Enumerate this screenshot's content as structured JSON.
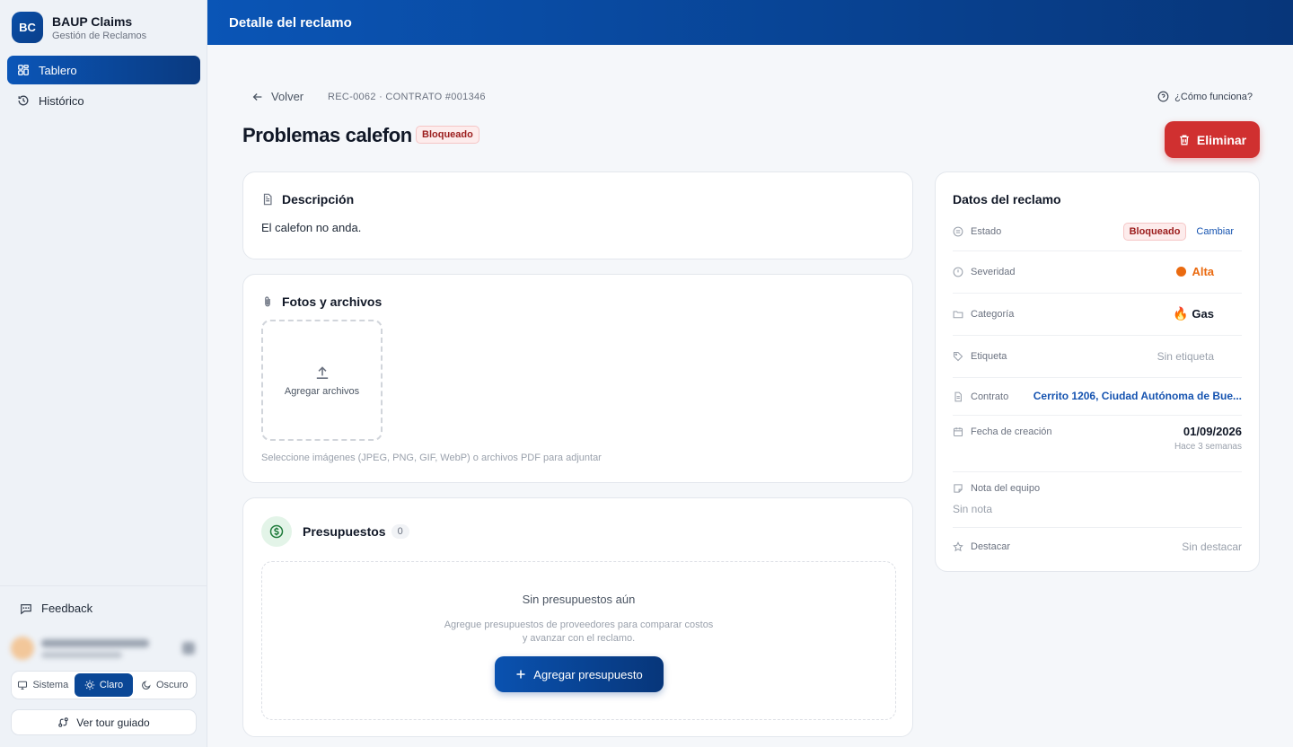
{
  "brand": {
    "initials": "BC",
    "name": "BAUP Claims",
    "subtitle": "Gestión de Reclamos"
  },
  "nav": [
    {
      "label": "Tablero",
      "icon": "dashboard-icon",
      "active": true
    },
    {
      "label": "Histórico",
      "icon": "history-icon",
      "active": false
    }
  ],
  "sidebar_footer": {
    "feedback": "Feedback",
    "theme": {
      "system": "Sistema",
      "light": "Claro",
      "dark": "Oscuro",
      "selected": "Claro"
    },
    "tour": "Ver tour guiado"
  },
  "topbar": {
    "title": "Detalle del reclamo"
  },
  "header": {
    "back": "Volver",
    "breadcrumb": "REC-0062 · CONTRATO #001346",
    "help": "¿Cómo funciona?",
    "title": "Problemas calefon",
    "status": "Bloqueado",
    "delete": "Eliminar"
  },
  "description": {
    "title": "Descripción",
    "text": "El calefon no anda."
  },
  "files": {
    "title": "Fotos y archivos",
    "upload": "Agregar archivos",
    "help": "Seleccione imágenes (JPEG, PNG, GIF, WebP) o archivos PDF para adjuntar"
  },
  "budgets": {
    "title": "Presupuestos",
    "count": "0",
    "empty_title": "Sin presupuestos aún",
    "empty_desc": "Agregue presupuestos de proveedores para comparar costos y avanzar con el reclamo.",
    "add": "Agregar presupuesto"
  },
  "details": {
    "title": "Datos del reclamo",
    "estado": {
      "label": "Estado",
      "value": "Bloqueado",
      "action": "Cambiar"
    },
    "severidad": {
      "label": "Severidad",
      "value": "Alta",
      "color": "#ea6a10"
    },
    "categoria": {
      "label": "Categoría",
      "value": "Gas",
      "emoji": "🔥"
    },
    "etiqueta": {
      "label": "Etiqueta",
      "value": "Sin etiqueta"
    },
    "contrato": {
      "label": "Contrato",
      "value": "Cerrito 1206, Ciudad Autónoma de Bue..."
    },
    "fecha": {
      "label": "Fecha de creación",
      "value": "01/09/2026",
      "relative": "Hace 3 semanas"
    },
    "nota": {
      "label": "Nota del equipo",
      "value": "Sin nota"
    },
    "destacar": {
      "label": "Destacar",
      "value": "Sin destacar"
    }
  },
  "colors": {
    "primary": "#0a4fa8",
    "danger": "#d03030",
    "accent_link": "#1553b0"
  }
}
